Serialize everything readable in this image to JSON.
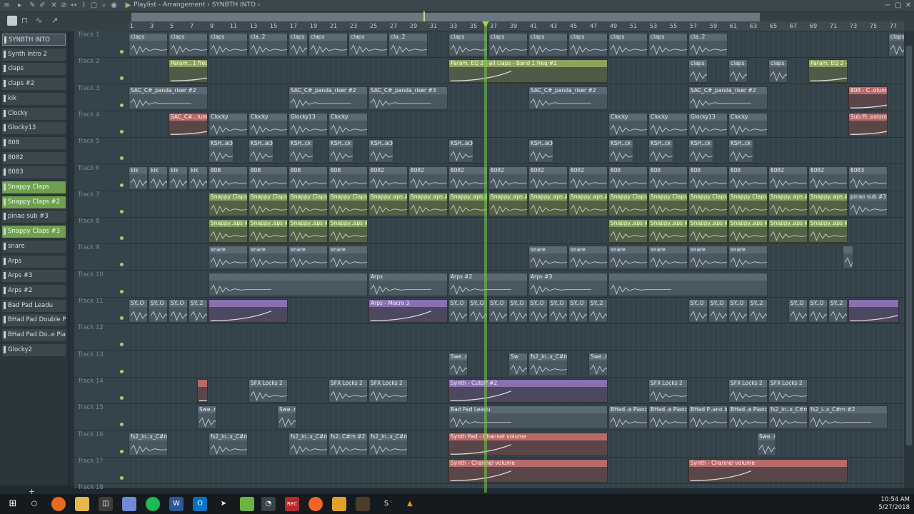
{
  "window": {
    "title": "Playlist - Arrangement",
    "arrangement": "SYNBTH INTO"
  },
  "patterns": [
    {
      "label": "SYNBTH INTO",
      "style": "sel"
    },
    {
      "label": "Synth Intro 2",
      "style": ""
    },
    {
      "label": "claps",
      "style": ""
    },
    {
      "label": "claps #2",
      "style": ""
    },
    {
      "label": "kik",
      "style": ""
    },
    {
      "label": "Clocky",
      "style": ""
    },
    {
      "label": "Glocky13",
      "style": ""
    },
    {
      "label": "808",
      "style": ""
    },
    {
      "label": "8082",
      "style": ""
    },
    {
      "label": "8083",
      "style": ""
    },
    {
      "label": "Snappy Claps",
      "style": "green"
    },
    {
      "label": "Snappy Claps #2",
      "style": "green"
    },
    {
      "label": "pinao sub #3",
      "style": ""
    },
    {
      "label": "Snappy Claps #3",
      "style": "green"
    },
    {
      "label": "snare",
      "style": ""
    },
    {
      "label": "Arps",
      "style": ""
    },
    {
      "label": "Arps #3",
      "style": ""
    },
    {
      "label": "Arps #2",
      "style": ""
    },
    {
      "label": "Bad Pad Leadu",
      "style": ""
    },
    {
      "label": "BHad Pad Double Piano",
      "style": ""
    },
    {
      "label": "BHad Pad Do..e Piano #2",
      "style": ""
    },
    {
      "label": "Glocky2",
      "style": ""
    }
  ],
  "tracks": [
    "Track 1",
    "Track 2",
    "Track 3",
    "Track 4",
    "Track 5",
    "Track 6",
    "Track 7",
    "Track 8",
    "Track 9",
    "Track 10",
    "Track 11",
    "Track 12",
    "Track 13",
    "Track 14",
    "Track 15",
    "Track 16",
    "Track 17",
    "Track 18"
  ],
  "ruler": [
    "1",
    "3",
    "5",
    "7",
    "9",
    "11",
    "13",
    "15",
    "17",
    "19",
    "21",
    "23",
    "25",
    "27",
    "29",
    "31",
    "33",
    "35",
    "37",
    "39",
    "41",
    "43",
    "45",
    "47",
    "49",
    "51",
    "53",
    "55",
    "57",
    "59",
    "61",
    "63",
    "65",
    "67",
    "69",
    "71",
    "73",
    "75",
    "77"
  ],
  "clips": [
    {
      "t": 0,
      "s": 0,
      "w": 14,
      "c": "gray",
      "l": "claps"
    },
    {
      "t": 0,
      "s": 14,
      "w": 14,
      "c": "gray",
      "l": "claps"
    },
    {
      "t": 0,
      "s": 28,
      "w": 14,
      "c": "gray",
      "l": "claps"
    },
    {
      "t": 0,
      "s": 42,
      "w": 14,
      "c": "gray",
      "l": "cla..2"
    },
    {
      "t": 0,
      "s": 56,
      "w": 7,
      "c": "gray",
      "l": "claps"
    },
    {
      "t": 0,
      "s": 63,
      "w": 14,
      "c": "gray",
      "l": "claps"
    },
    {
      "t": 0,
      "s": 77,
      "w": 14,
      "c": "gray",
      "l": "claps"
    },
    {
      "t": 0,
      "s": 91,
      "w": 14,
      "c": "gray",
      "l": "cla..2"
    },
    {
      "t": 0,
      "s": 112,
      "w": 14,
      "c": "gray",
      "l": "claps"
    },
    {
      "t": 0,
      "s": 126,
      "w": 14,
      "c": "gray",
      "l": "claps"
    },
    {
      "t": 0,
      "s": 140,
      "w": 14,
      "c": "gray",
      "l": "claps"
    },
    {
      "t": 0,
      "s": 154,
      "w": 14,
      "c": "gray",
      "l": "claps"
    },
    {
      "t": 0,
      "s": 168,
      "w": 14,
      "c": "gray",
      "l": "claps"
    },
    {
      "t": 0,
      "s": 182,
      "w": 14,
      "c": "gray",
      "l": "claps"
    },
    {
      "t": 0,
      "s": 196,
      "w": 14,
      "c": "gray",
      "l": "cla..2"
    },
    {
      "t": 0,
      "s": 266,
      "w": 14,
      "c": "gray",
      "l": "claps"
    },
    {
      "t": 0,
      "s": 280,
      "w": 14,
      "c": "gray",
      "l": "cla..2"
    },
    {
      "t": 1,
      "s": 14,
      "w": 14,
      "c": "olive",
      "l": "Param.. 1 freq"
    },
    {
      "t": 1,
      "s": 112,
      "w": 56,
      "c": "olive",
      "l": "Param. EQ 2 - all claps - Band 1 freq #2"
    },
    {
      "t": 1,
      "s": 196,
      "w": 7,
      "c": "gray",
      "l": "claps"
    },
    {
      "t": 1,
      "s": 210,
      "w": 7,
      "c": "gray",
      "l": "claps"
    },
    {
      "t": 1,
      "s": 224,
      "w": 7,
      "c": "gray",
      "l": "claps"
    },
    {
      "t": 1,
      "s": 238,
      "w": 14,
      "c": "olive",
      "l": "Param. EQ 2 - al.. - Band 1 freq #3"
    },
    {
      "t": 2,
      "s": 0,
      "w": 28,
      "c": "gray",
      "l": "SAC_C#_panda_riser #2"
    },
    {
      "t": 2,
      "s": 56,
      "w": 28,
      "c": "gray",
      "l": "SAC_C#_panda_riser #2"
    },
    {
      "t": 2,
      "s": 84,
      "w": 28,
      "c": "gray",
      "l": "SAC_C#_panda_riser #3"
    },
    {
      "t": 2,
      "s": 140,
      "w": 28,
      "c": "gray",
      "l": "SAC_C#_panda_riser #2"
    },
    {
      "t": 2,
      "s": 196,
      "w": 28,
      "c": "gray",
      "l": "SAC_C#_panda_riser #2"
    },
    {
      "t": 2,
      "s": 252,
      "w": 14,
      "c": "red",
      "l": "808 - C..olume"
    },
    {
      "t": 3,
      "s": 14,
      "w": 14,
      "c": "red",
      "l": "SAC_C#...lume"
    },
    {
      "t": 3,
      "s": 28,
      "w": 14,
      "c": "gray",
      "l": "Clocky"
    },
    {
      "t": 3,
      "s": 42,
      "w": 14,
      "c": "gray",
      "l": "Clocky"
    },
    {
      "t": 3,
      "s": 56,
      "w": 14,
      "c": "gray",
      "l": "Glocky13"
    },
    {
      "t": 3,
      "s": 70,
      "w": 14,
      "c": "gray",
      "l": "Clocky"
    },
    {
      "t": 3,
      "s": 168,
      "w": 14,
      "c": "gray",
      "l": "Clocky"
    },
    {
      "t": 3,
      "s": 182,
      "w": 14,
      "c": "gray",
      "l": "Clocky"
    },
    {
      "t": 3,
      "s": 196,
      "w": 14,
      "c": "gray",
      "l": "Glocky13"
    },
    {
      "t": 3,
      "s": 210,
      "w": 14,
      "c": "gray",
      "l": "Clocky"
    },
    {
      "t": 3,
      "s": 252,
      "w": 14,
      "c": "red",
      "l": "Sub Pi..volume"
    },
    {
      "t": 4,
      "s": 28,
      "w": 9,
      "c": "gray",
      "l": "KSH..ack"
    },
    {
      "t": 4,
      "s": 42,
      "w": 9,
      "c": "gray",
      "l": "KSH..ack"
    },
    {
      "t": 4,
      "s": 56,
      "w": 9,
      "c": "gray",
      "l": "KSH..ck"
    },
    {
      "t": 4,
      "s": 70,
      "w": 9,
      "c": "gray",
      "l": "KSH..ck"
    },
    {
      "t": 4,
      "s": 84,
      "w": 9,
      "c": "gray",
      "l": "KSH..ack"
    },
    {
      "t": 4,
      "s": 112,
      "w": 9,
      "c": "gray",
      "l": "KSH..ack"
    },
    {
      "t": 4,
      "s": 140,
      "w": 9,
      "c": "gray",
      "l": "KSH..ack"
    },
    {
      "t": 4,
      "s": 168,
      "w": 9,
      "c": "gray",
      "l": "KSH..ck"
    },
    {
      "t": 4,
      "s": 182,
      "w": 9,
      "c": "gray",
      "l": "KSH..ck"
    },
    {
      "t": 4,
      "s": 196,
      "w": 9,
      "c": "gray",
      "l": "KSH..ck"
    },
    {
      "t": 4,
      "s": 210,
      "w": 9,
      "c": "gray",
      "l": "KSH..ck"
    },
    {
      "t": 5,
      "s": 0,
      "w": 7,
      "c": "gray",
      "l": "kik"
    },
    {
      "t": 5,
      "s": 7,
      "w": 7,
      "c": "gray",
      "l": "kik"
    },
    {
      "t": 5,
      "s": 14,
      "w": 7,
      "c": "gray",
      "l": "kik"
    },
    {
      "t": 5,
      "s": 21,
      "w": 7,
      "c": "gray",
      "l": "kik"
    },
    {
      "t": 5,
      "s": 28,
      "w": 14,
      "c": "gray",
      "l": "808"
    },
    {
      "t": 5,
      "s": 42,
      "w": 14,
      "c": "gray",
      "l": "808"
    },
    {
      "t": 5,
      "s": 56,
      "w": 14,
      "c": "gray",
      "l": "808"
    },
    {
      "t": 5,
      "s": 70,
      "w": 14,
      "c": "gray",
      "l": "808"
    },
    {
      "t": 5,
      "s": 84,
      "w": 14,
      "c": "gray",
      "l": "8082"
    },
    {
      "t": 5,
      "s": 98,
      "w": 14,
      "c": "gray",
      "l": "8082"
    },
    {
      "t": 5,
      "s": 112,
      "w": 14,
      "c": "gray",
      "l": "8082"
    },
    {
      "t": 5,
      "s": 126,
      "w": 14,
      "c": "gray",
      "l": "8082"
    },
    {
      "t": 5,
      "s": 140,
      "w": 14,
      "c": "gray",
      "l": "8082"
    },
    {
      "t": 5,
      "s": 154,
      "w": 14,
      "c": "gray",
      "l": "8082"
    },
    {
      "t": 5,
      "s": 168,
      "w": 14,
      "c": "gray",
      "l": "808"
    },
    {
      "t": 5,
      "s": 182,
      "w": 14,
      "c": "gray",
      "l": "808"
    },
    {
      "t": 5,
      "s": 196,
      "w": 14,
      "c": "gray",
      "l": "808"
    },
    {
      "t": 5,
      "s": 210,
      "w": 14,
      "c": "gray",
      "l": "808"
    },
    {
      "t": 5,
      "s": 224,
      "w": 14,
      "c": "gray",
      "l": "8082"
    },
    {
      "t": 5,
      "s": 238,
      "w": 14,
      "c": "gray",
      "l": "8082"
    },
    {
      "t": 5,
      "s": 252,
      "w": 14,
      "c": "gray",
      "l": "8083"
    },
    {
      "t": 6,
      "s": 28,
      "w": 14,
      "c": "green",
      "l": "Snappy Claps"
    },
    {
      "t": 6,
      "s": 42,
      "w": 14,
      "c": "green",
      "l": "Snappy Claps"
    },
    {
      "t": 6,
      "s": 56,
      "w": 14,
      "c": "green",
      "l": "Snappy Claps"
    },
    {
      "t": 6,
      "s": 70,
      "w": 14,
      "c": "green",
      "l": "Snappy Claps"
    },
    {
      "t": 6,
      "s": 84,
      "w": 14,
      "c": "green",
      "l": "Snappy..aps #2"
    },
    {
      "t": 6,
      "s": 98,
      "w": 14,
      "c": "green",
      "l": "Snappy..aps #2"
    },
    {
      "t": 6,
      "s": 112,
      "w": 14,
      "c": "green",
      "l": "Snappy..aps #2"
    },
    {
      "t": 6,
      "s": 126,
      "w": 14,
      "c": "green",
      "l": "Snappy..aps #2"
    },
    {
      "t": 6,
      "s": 140,
      "w": 14,
      "c": "green",
      "l": "Snappy..aps #2"
    },
    {
      "t": 6,
      "s": 154,
      "w": 14,
      "c": "green",
      "l": "Snappy..aps #2"
    },
    {
      "t": 6,
      "s": 168,
      "w": 14,
      "c": "green",
      "l": "Snappy Claps"
    },
    {
      "t": 6,
      "s": 182,
      "w": 14,
      "c": "green",
      "l": "Snappy Claps"
    },
    {
      "t": 6,
      "s": 196,
      "w": 14,
      "c": "green",
      "l": "Snappy Claps"
    },
    {
      "t": 6,
      "s": 210,
      "w": 14,
      "c": "green",
      "l": "Snappy Claps"
    },
    {
      "t": 6,
      "s": 224,
      "w": 14,
      "c": "green",
      "l": "Snappy..aps #2"
    },
    {
      "t": 6,
      "s": 238,
      "w": 14,
      "c": "green",
      "l": "Snappy..aps #2"
    },
    {
      "t": 6,
      "s": 252,
      "w": 14,
      "c": "gray",
      "l": "pinao sub #3"
    },
    {
      "t": 7,
      "s": 28,
      "w": 14,
      "c": "green",
      "l": "Snappy..aps #3"
    },
    {
      "t": 7,
      "s": 42,
      "w": 14,
      "c": "green",
      "l": "Snappy..aps #3"
    },
    {
      "t": 7,
      "s": 56,
      "w": 14,
      "c": "green",
      "l": "Snappy..aps #3"
    },
    {
      "t": 7,
      "s": 70,
      "w": 14,
      "c": "green",
      "l": "Snappy..aps #3"
    },
    {
      "t": 7,
      "s": 168,
      "w": 14,
      "c": "green",
      "l": "Snappy..aps #3"
    },
    {
      "t": 7,
      "s": 182,
      "w": 14,
      "c": "green",
      "l": "Snappy..aps #3"
    },
    {
      "t": 7,
      "s": 196,
      "w": 14,
      "c": "green",
      "l": "Snappy..aps #3"
    },
    {
      "t": 7,
      "s": 210,
      "w": 14,
      "c": "green",
      "l": "Snappy..aps #3"
    },
    {
      "t": 7,
      "s": 224,
      "w": 14,
      "c": "green",
      "l": "Snappy..aps #3"
    },
    {
      "t": 7,
      "s": 238,
      "w": 14,
      "c": "green",
      "l": "Snappy..aps #3"
    },
    {
      "t": 8,
      "s": 28,
      "w": 14,
      "c": "gray",
      "l": "snare"
    },
    {
      "t": 8,
      "s": 42,
      "w": 14,
      "c": "gray",
      "l": "snare"
    },
    {
      "t": 8,
      "s": 56,
      "w": 14,
      "c": "gray",
      "l": "snare"
    },
    {
      "t": 8,
      "s": 70,
      "w": 14,
      "c": "gray",
      "l": "snare"
    },
    {
      "t": 8,
      "s": 140,
      "w": 14,
      "c": "gray",
      "l": "snare"
    },
    {
      "t": 8,
      "s": 154,
      "w": 14,
      "c": "gray",
      "l": "snare"
    },
    {
      "t": 8,
      "s": 168,
      "w": 14,
      "c": "gray",
      "l": "snare"
    },
    {
      "t": 8,
      "s": 182,
      "w": 14,
      "c": "gray",
      "l": "snare"
    },
    {
      "t": 8,
      "s": 196,
      "w": 14,
      "c": "gray",
      "l": "snare"
    },
    {
      "t": 8,
      "s": 210,
      "w": 14,
      "c": "gray",
      "l": "snare"
    },
    {
      "t": 8,
      "s": 250,
      "w": 4,
      "c": "gray",
      "l": ""
    },
    {
      "t": 9,
      "s": 28,
      "w": 56,
      "c": "gray",
      "l": ""
    },
    {
      "t": 9,
      "s": 84,
      "w": 28,
      "c": "gray",
      "l": "Arps"
    },
    {
      "t": 9,
      "s": 112,
      "w": 28,
      "c": "gray",
      "l": "Arps #2"
    },
    {
      "t": 9,
      "s": 140,
      "w": 28,
      "c": "gray",
      "l": "Arps #3"
    },
    {
      "t": 9,
      "s": 168,
      "w": 56,
      "c": "gray",
      "l": ""
    },
    {
      "t": 10,
      "s": 0,
      "w": 7,
      "c": "gray",
      "l": "SY..O"
    },
    {
      "t": 10,
      "s": 7,
      "w": 7,
      "c": "gray",
      "l": "SY..O"
    },
    {
      "t": 10,
      "s": 14,
      "w": 7,
      "c": "gray",
      "l": "SY..O"
    },
    {
      "t": 10,
      "s": 21,
      "w": 7,
      "c": "gray",
      "l": "SY..2"
    },
    {
      "t": 10,
      "s": 28,
      "w": 28,
      "c": "purple",
      "l": ""
    },
    {
      "t": 10,
      "s": 84,
      "w": 28,
      "c": "purple",
      "l": "Arps - Macro 3"
    },
    {
      "t": 10,
      "s": 112,
      "w": 7,
      "c": "gray",
      "l": "SY..O"
    },
    {
      "t": 10,
      "s": 119,
      "w": 7,
      "c": "gray",
      "l": "SY..O"
    },
    {
      "t": 10,
      "s": 126,
      "w": 7,
      "c": "gray",
      "l": "SY..O"
    },
    {
      "t": 10,
      "s": 133,
      "w": 7,
      "c": "gray",
      "l": "SY..O"
    },
    {
      "t": 10,
      "s": 140,
      "w": 7,
      "c": "gray",
      "l": "SY..O"
    },
    {
      "t": 10,
      "s": 147,
      "w": 7,
      "c": "gray",
      "l": "SY..O"
    },
    {
      "t": 10,
      "s": 154,
      "w": 7,
      "c": "gray",
      "l": "SY..O"
    },
    {
      "t": 10,
      "s": 161,
      "w": 7,
      "c": "gray",
      "l": "SY..2"
    },
    {
      "t": 10,
      "s": 196,
      "w": 7,
      "c": "gray",
      "l": "SY..O"
    },
    {
      "t": 10,
      "s": 203,
      "w": 7,
      "c": "gray",
      "l": "SY..O"
    },
    {
      "t": 10,
      "s": 210,
      "w": 7,
      "c": "gray",
      "l": "SY..O"
    },
    {
      "t": 10,
      "s": 217,
      "w": 7,
      "c": "gray",
      "l": "SY..2"
    },
    {
      "t": 10,
      "s": 231,
      "w": 7,
      "c": "gray",
      "l": "SY..O"
    },
    {
      "t": 10,
      "s": 238,
      "w": 7,
      "c": "gray",
      "l": "SY..O"
    },
    {
      "t": 10,
      "s": 245,
      "w": 7,
      "c": "gray",
      "l": "SY..2"
    },
    {
      "t": 10,
      "s": 252,
      "w": 18,
      "c": "purple",
      "l": ""
    },
    {
      "t": 12,
      "s": 112,
      "w": 7,
      "c": "gray",
      "l": "Swe..re"
    },
    {
      "t": 12,
      "s": 133,
      "w": 7,
      "c": "gray",
      "l": "Sw"
    },
    {
      "t": 12,
      "s": 140,
      "w": 14,
      "c": "gray",
      "l": "fs2_in..x_C#m"
    },
    {
      "t": 12,
      "s": 161,
      "w": 7,
      "c": "gray",
      "l": "Swe..re"
    },
    {
      "t": 13,
      "s": 24,
      "w": 4,
      "c": "red",
      "l": ""
    },
    {
      "t": 13,
      "s": 42,
      "w": 14,
      "c": "gray",
      "l": "SFX Locks 2"
    },
    {
      "t": 13,
      "s": 70,
      "w": 14,
      "c": "gray",
      "l": "SFX Locks 2"
    },
    {
      "t": 13,
      "s": 84,
      "w": 14,
      "c": "gray",
      "l": "SFX Locks 2"
    },
    {
      "t": 13,
      "s": 112,
      "w": 56,
      "c": "purple",
      "l": "Synth - Cutoff #2"
    },
    {
      "t": 13,
      "s": 182,
      "w": 14,
      "c": "gray",
      "l": "SFX Locks 2"
    },
    {
      "t": 13,
      "s": 210,
      "w": 14,
      "c": "gray",
      "l": "SFX Locks 2"
    },
    {
      "t": 13,
      "s": 224,
      "w": 14,
      "c": "gray",
      "l": "SFX Locks 2"
    },
    {
      "t": 14,
      "s": 24,
      "w": 7,
      "c": "gray",
      "l": "Swe..re"
    },
    {
      "t": 14,
      "s": 52,
      "w": 7,
      "c": "gray",
      "l": "Swe..re"
    },
    {
      "t": 14,
      "s": 112,
      "w": 56,
      "c": "gray",
      "l": "Bad Pad Leadu"
    },
    {
      "t": 14,
      "s": 168,
      "w": 14,
      "c": "gray",
      "l": "BHad..e Piano"
    },
    {
      "t": 14,
      "s": 182,
      "w": 14,
      "c": "gray",
      "l": "BHad..e Piano"
    },
    {
      "t": 14,
      "s": 196,
      "w": 14,
      "c": "gray",
      "l": "BHad P..ano #2"
    },
    {
      "t": 14,
      "s": 210,
      "w": 14,
      "c": "gray",
      "l": "BHad..e Piano"
    },
    {
      "t": 14,
      "s": 224,
      "w": 14,
      "c": "gray",
      "l": "fs2_in..x_C#m"
    },
    {
      "t": 14,
      "s": 238,
      "w": 28,
      "c": "gray",
      "l": "fs2_i..x_C#m #2"
    },
    {
      "t": 15,
      "s": 0,
      "w": 14,
      "c": "gray",
      "l": "fs2_in..x_C#m"
    },
    {
      "t": 15,
      "s": 28,
      "w": 14,
      "c": "gray",
      "l": "fs2_in..x_C#m"
    },
    {
      "t": 15,
      "s": 56,
      "w": 14,
      "c": "gray",
      "l": "fs2_in..x_C#m"
    },
    {
      "t": 15,
      "s": 70,
      "w": 14,
      "c": "gray",
      "l": "fs2..C#m #2"
    },
    {
      "t": 15,
      "s": 84,
      "w": 14,
      "c": "gray",
      "l": "fs2_in..x_C#m"
    },
    {
      "t": 15,
      "s": 112,
      "w": 56,
      "c": "red",
      "l": "Synth Pad - Channel volume"
    },
    {
      "t": 15,
      "s": 220,
      "w": 7,
      "c": "gray",
      "l": "Swe..re"
    },
    {
      "t": 16,
      "s": 112,
      "w": 56,
      "c": "red",
      "l": "Synth - Channel volume"
    },
    {
      "t": 16,
      "s": 196,
      "w": 56,
      "c": "red",
      "l": "Synth - Channel volume"
    }
  ],
  "taskbar": {
    "time": "10:54 AM",
    "date": "5/27/2018"
  }
}
